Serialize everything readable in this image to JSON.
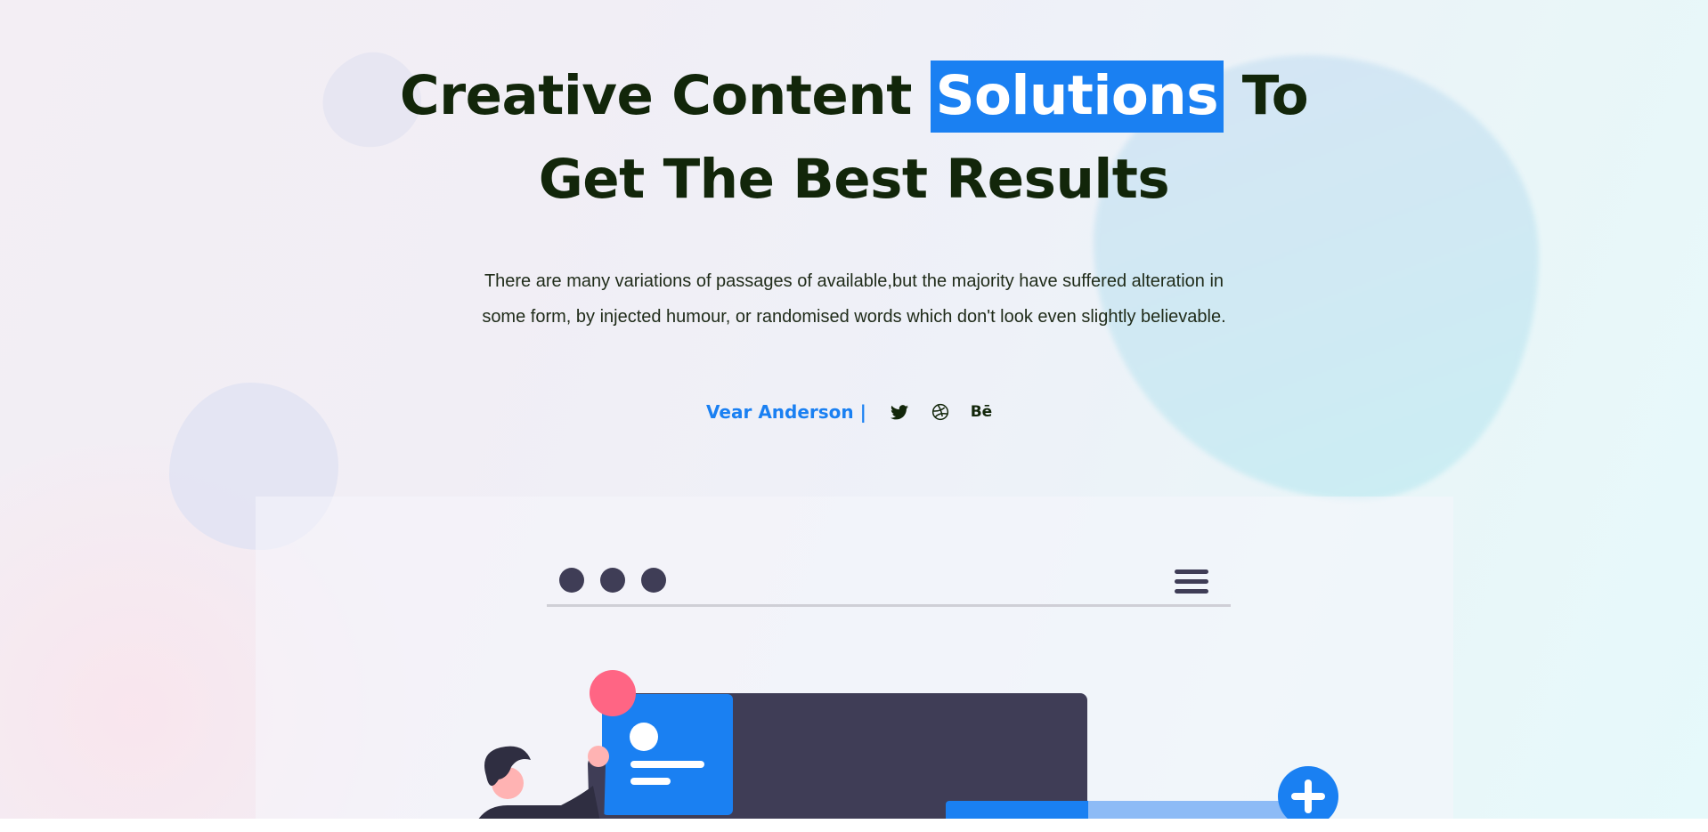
{
  "hero": {
    "title_line1_before": "Creative Content",
    "title_highlight": "Solutions",
    "title_line1_after": "To",
    "title_line2": "Get The Best Results",
    "description": "There are many variations of passages of available,but the majority have suffered alteration in some form, by injected humour, or randomised words which don't look even slightly believable.",
    "author": "Vear Anderson |",
    "social": [
      {
        "icon": "twitter-icon",
        "label": ""
      },
      {
        "icon": "dribbble-icon",
        "label": ""
      },
      {
        "icon": "behance-icon",
        "label": "Bē"
      }
    ]
  },
  "colors": {
    "accent": "#1a80f2",
    "heading": "#12260a",
    "illustration_dark": "#3f3d56",
    "illustration_pink": "#ff6584"
  }
}
